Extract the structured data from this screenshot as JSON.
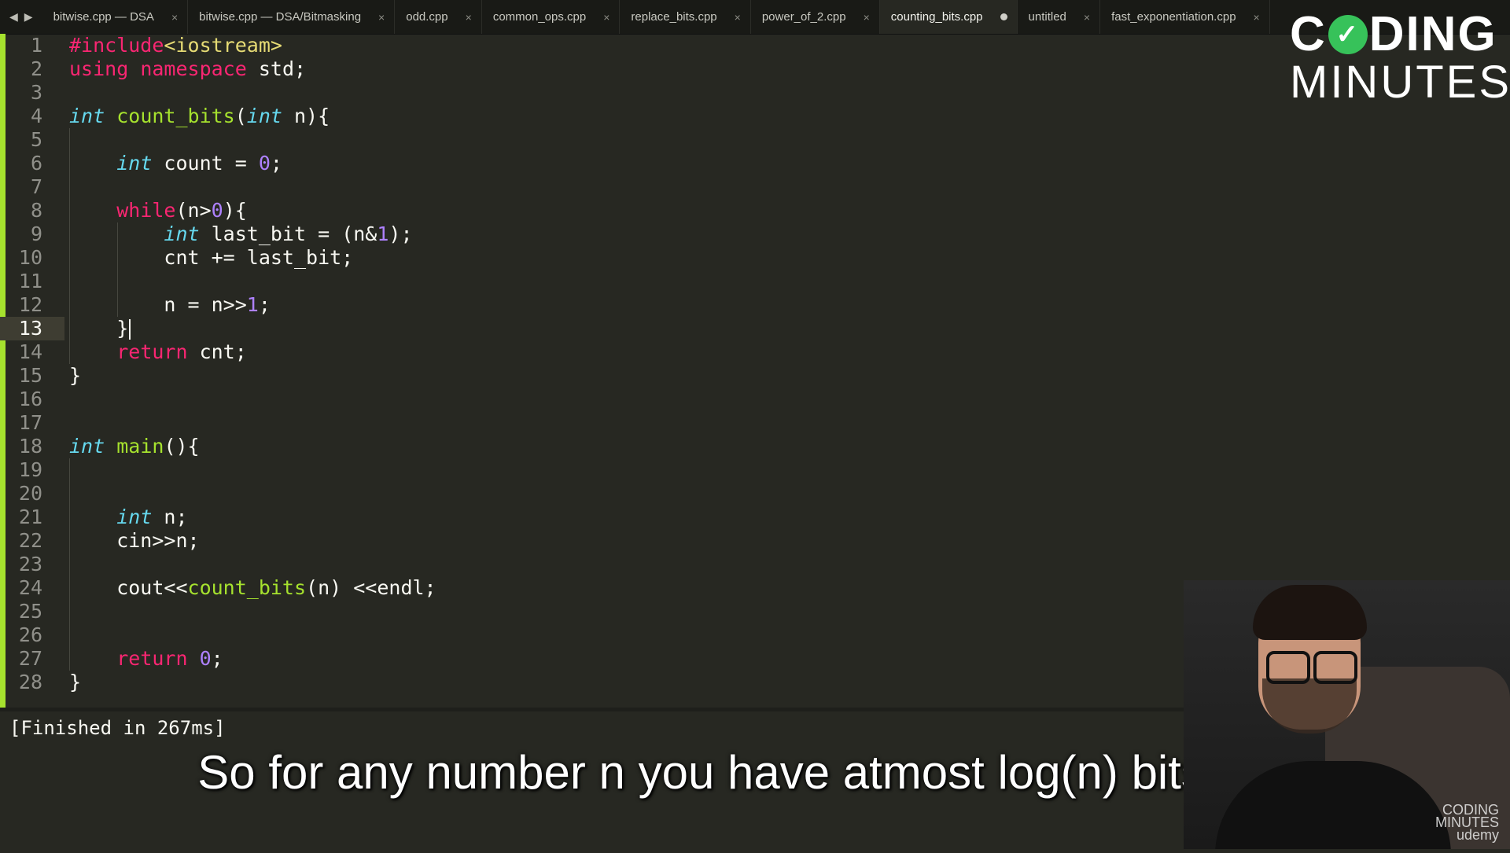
{
  "tabbar": {
    "back_glyph": "◀",
    "forward_glyph": "▶",
    "tabs": [
      {
        "label": "bitwise.cpp — DSA",
        "active": false,
        "modified": false
      },
      {
        "label": "bitwise.cpp — DSA/Bitmasking",
        "active": false,
        "modified": false
      },
      {
        "label": "odd.cpp",
        "active": false,
        "modified": false
      },
      {
        "label": "common_ops.cpp",
        "active": false,
        "modified": false
      },
      {
        "label": "replace_bits.cpp",
        "active": false,
        "modified": false
      },
      {
        "label": "power_of_2.cpp",
        "active": false,
        "modified": false
      },
      {
        "label": "counting_bits.cpp",
        "active": true,
        "modified": true
      },
      {
        "label": "untitled",
        "active": false,
        "modified": false
      },
      {
        "label": "fast_exponentiation.cpp",
        "active": false,
        "modified": false
      }
    ],
    "close_glyph": "×"
  },
  "editor": {
    "language": "C++",
    "current_line": 13,
    "line_numbers": [
      "1",
      "2",
      "3",
      "4",
      "5",
      "6",
      "7",
      "8",
      "9",
      "10",
      "11",
      "12",
      "13",
      "14",
      "15",
      "16",
      "17",
      "18",
      "19",
      "20",
      "21",
      "22",
      "23",
      "24",
      "25",
      "26",
      "27",
      "28"
    ],
    "lines": [
      "#include<iostream>",
      "using namespace std;",
      "",
      "int count_bits(int n){",
      "",
      "    int count = 0;",
      "",
      "    while(n>0){",
      "        int last_bit = (n&1);",
      "        cnt += last_bit;",
      "",
      "        n = n>>1;",
      "    }",
      "    return cnt;",
      "}",
      "",
      "",
      "int main(){",
      "",
      "",
      "    int n;",
      "    cin>>n;",
      "",
      "    cout<<count_bits(n) <<endl;",
      "",
      "",
      "    return 0;",
      "}"
    ]
  },
  "output": {
    "text": "[Finished in 267ms]"
  },
  "subtitle": {
    "text": "So for any number n you have atmost log(n) bits and"
  },
  "logo": {
    "line1_left": "C",
    "line1_right": "DING",
    "line2": "MINUTES",
    "check_glyph": "✓"
  },
  "watermark": {
    "line1": "CODING",
    "line2": "MINUTES",
    "brand": "udemy"
  },
  "colors": {
    "background": "#272822",
    "keyword": "#f92672",
    "type": "#66d9ef",
    "function": "#a6e22e",
    "number": "#ae81ff",
    "string": "#e6db74"
  }
}
